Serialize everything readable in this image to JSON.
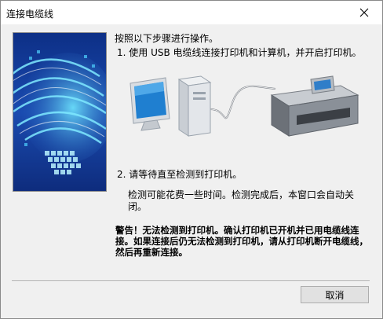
{
  "window": {
    "title": "连接电缆线"
  },
  "title_bar": {
    "close_icon": "close-icon"
  },
  "content": {
    "heading": "按照以下步骤进行操作。",
    "step1": "1.  使用 USB 电缆线连接打印机和计算机，并开启打印机。",
    "step2": "2.  请等待直至检测到打印机。",
    "detect_note": "检测可能花费一些时间。检测完成后，本窗口会自动关闭。",
    "warning": "警告！无法检测到打印机。确认打印机已开机并已用电缆线连接。如果连接后仍无法检测到打印机，请从打印机断开电缆线，然后再重新连接。"
  },
  "buttons": {
    "cancel": "取消"
  },
  "colors": {
    "banner_blue": "#123c92",
    "accent_cyan": "#4fd2ff",
    "button_bg": "#e1e1e1"
  }
}
